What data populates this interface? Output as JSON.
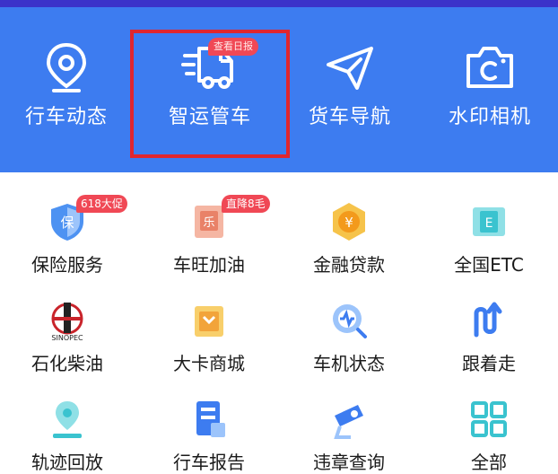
{
  "tools": [
    {
      "label": "行车动态",
      "icon": "location-pin-icon"
    },
    {
      "label": "智运管车",
      "icon": "truck-icon",
      "badge": "查看日报"
    },
    {
      "label": "货车导航",
      "icon": "navigation-arrow-icon"
    },
    {
      "label": "水印相机",
      "icon": "camera-icon"
    }
  ],
  "services": [
    {
      "label": "保险服务",
      "icon": "insurance-shield-icon",
      "badge": "618大促"
    },
    {
      "label": "车旺加油",
      "icon": "fuel-icon",
      "badge": "直降8毛"
    },
    {
      "label": "金融贷款",
      "icon": "loan-coin-icon"
    },
    {
      "label": "全国ETC",
      "icon": "etc-card-icon"
    },
    {
      "label": "石化柴油",
      "icon": "sinopec-logo-icon"
    },
    {
      "label": "大卡商城",
      "icon": "shopping-bag-icon"
    },
    {
      "label": "车机状态",
      "icon": "device-status-icon"
    },
    {
      "label": "跟着走",
      "icon": "follow-route-icon"
    },
    {
      "label": "轨迹回放",
      "icon": "track-replay-icon"
    },
    {
      "label": "行车报告",
      "icon": "report-icon"
    },
    {
      "label": "违章查询",
      "icon": "camera-check-icon"
    },
    {
      "label": "全部",
      "icon": "grid-all-icon"
    }
  ],
  "sinopec_text": "SINOPEC",
  "colors": {
    "header_bg": "#3d7cf0",
    "top_strip": "#3b33c9",
    "badge": "#f04855",
    "highlight": "#e0262e"
  }
}
